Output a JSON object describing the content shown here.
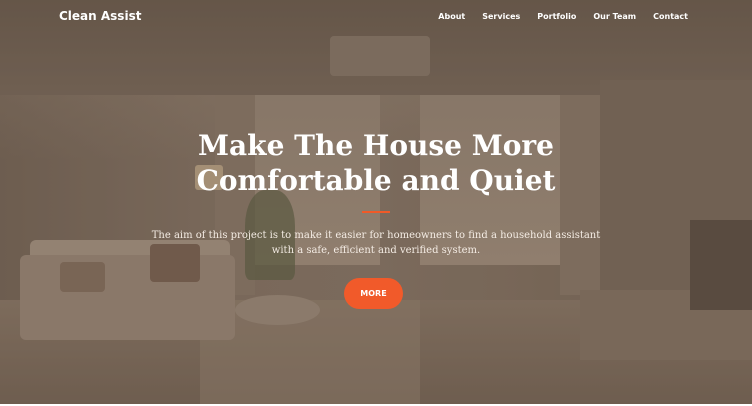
{
  "header": {
    "logo": "Clean Assist",
    "nav": [
      "About",
      "Services",
      "Portfolio",
      "Our Team",
      "Contact"
    ]
  },
  "hero": {
    "headline_line1": "Make The House More",
    "headline_line2": "Comfortable and Quiet",
    "subtitle_line1": "The aim of this project is to make it easier for homeowners to find a household assistant",
    "subtitle_line2": "with a safe, efficient and verified system.",
    "button": "MORE"
  },
  "colors": {
    "accent": "#f15a2a",
    "text": "#ffffff"
  }
}
